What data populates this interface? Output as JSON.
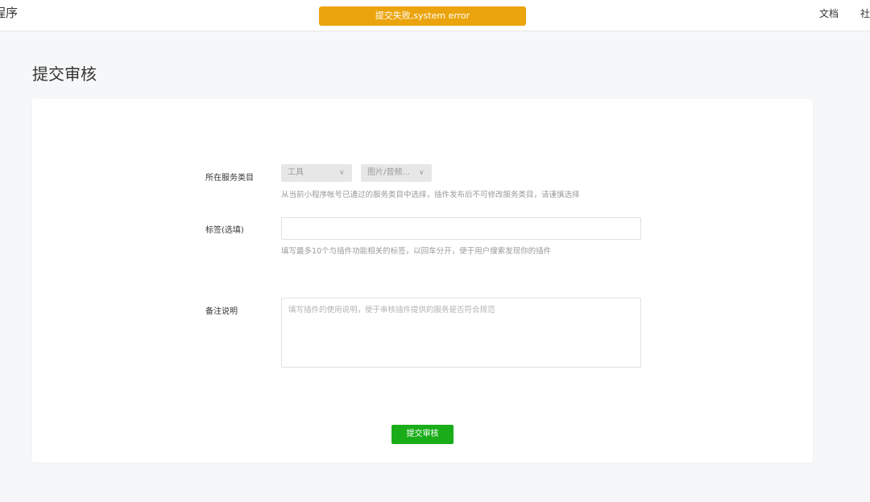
{
  "header": {
    "brand": "程序",
    "toast": "提交失败,system error",
    "nav": {
      "docs": "文档",
      "community": "社"
    }
  },
  "page": {
    "title": "提交审核"
  },
  "form": {
    "category": {
      "label": "所在服务类目",
      "primary_value": "工具",
      "secondary_value": "图片/音频...",
      "hint": "从当前小程序帐号已通过的服务类目中选择，插件发布后不可修改服务类目，请谨慎选择"
    },
    "tags": {
      "label": "标签(选填)",
      "value": "",
      "hint": "填写最多10个与插件功能相关的标签，以回车分开，便于用户搜索发现你的插件"
    },
    "remarks": {
      "label": "备注说明",
      "placeholder": "填写插件的使用说明，便于审核插件提供的服务是否符合规范"
    },
    "submit_label": "提交审核"
  },
  "icons": {
    "dropdown": "chevron-down-icon"
  },
  "colors": {
    "toast_bg": "#eba40d",
    "primary_button": "#1aad19",
    "page_bg": "#f6f7f8"
  }
}
